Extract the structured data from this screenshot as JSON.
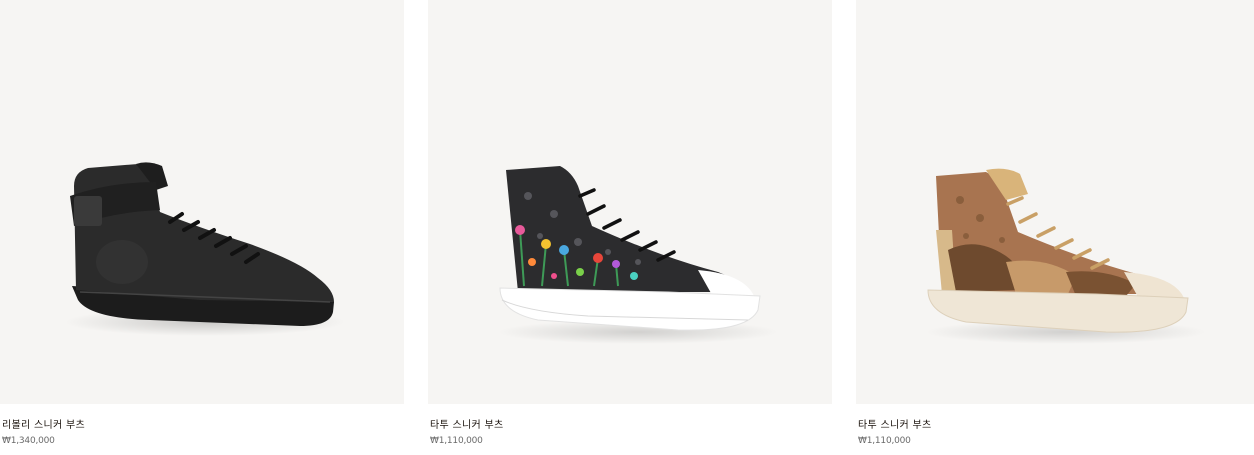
{
  "products": [
    {
      "name": "리볼리 스니커 부츠",
      "price": "₩1,340,000",
      "image": "black-leather-high-top-sneaker"
    },
    {
      "name": "타투 스니커 부츠",
      "price": "₩1,110,000",
      "image": "black-monogram-floral-high-top-sneaker"
    },
    {
      "name": "타투 스니커 부츠",
      "price": "₩1,110,000",
      "image": "brown-camouflage-monogram-high-top-sneaker"
    }
  ],
  "colors": {
    "image_background": "#f6f5f3",
    "name_text": "#19110b",
    "price_text": "#6a6a6a"
  }
}
